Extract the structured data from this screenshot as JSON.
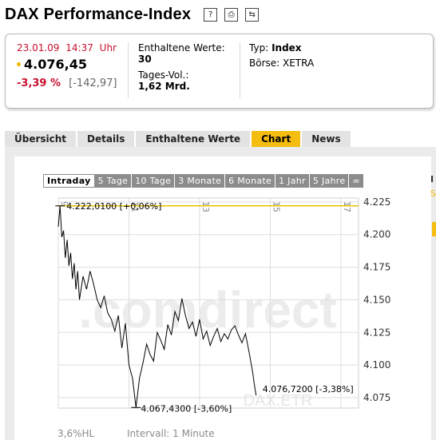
{
  "page": {
    "title": "DAX Performance-Index"
  },
  "title_icons": [
    {
      "name": "help-icon",
      "glyph": "?"
    },
    {
      "name": "print-icon",
      "glyph": "⎙"
    },
    {
      "name": "swap-icon",
      "glyph": "⇆"
    }
  ],
  "quote": {
    "date": "23.01.09",
    "time": "14:37 Uhr",
    "price": "4.076,45",
    "change_pct": "-3,39 %",
    "change_abs": "[-142,97]"
  },
  "stats": {
    "values_label": "Enthaltene Werte:",
    "values_count": "30",
    "volume_label": "Tages-Vol.:",
    "volume_value": "1,62 Mrd."
  },
  "meta": {
    "type_label": "Typ:",
    "type_value": "Index",
    "exchange": "Börse: XETRA"
  },
  "tabs": [
    "Übersicht",
    "Details",
    "Enthaltene Werte",
    "Chart",
    "News"
  ],
  "active_tab": "Chart",
  "chart_tabs": [
    "Intraday",
    "5 Tage",
    "10 Tage",
    "3 Monate",
    "6 Monate",
    "1 Jahr",
    "5 Jahre",
    "∞"
  ],
  "active_chart_tab": "Intraday",
  "right_cut_text": {
    "line1": "I",
    "line2": "S"
  },
  "footer": {
    "zoom": "3,6%HL",
    "interval": "Intervall: 1 Minute"
  },
  "colors": {
    "accent": "#f5bd0f",
    "negative": "#c8102e",
    "reference_line": "#e8c200"
  },
  "chart_data": {
    "type": "line",
    "title": "",
    "xlabel": "",
    "ylabel": "",
    "x_ticks": [
      "9",
      "11",
      "13",
      "15",
      "17"
    ],
    "y_ticks": [
      "4.225",
      "4.200",
      "4.175",
      "4.150",
      "4.125",
      "4.100",
      "4.075"
    ],
    "ylim": [
      4067,
      4228
    ],
    "xlim": [
      9,
      17.5
    ],
    "watermark": ".comdirect",
    "symbol_watermark": "DAX.ETR",
    "annotations": {
      "high": "4.222,0100 [+0,06%]",
      "low": "4.067,4300 [-3,60%]",
      "last": "4.076,7200 [-3,38%]"
    },
    "reference_value": 4222.01,
    "series": [
      {
        "name": "",
        "x": [
          9.0,
          9.05,
          9.1,
          9.15,
          9.2,
          9.25,
          9.3,
          9.35,
          9.4,
          9.45,
          9.5,
          9.55,
          9.6,
          9.7,
          9.8,
          9.9,
          10.0,
          10.1,
          10.2,
          10.3,
          10.4,
          10.5,
          10.6,
          10.7,
          10.8,
          10.9,
          11.0,
          11.1,
          11.2,
          11.3,
          11.4,
          11.5,
          11.6,
          11.7,
          11.8,
          11.9,
          12.0,
          12.1,
          12.2,
          12.3,
          12.4,
          12.5,
          12.6,
          12.7,
          12.8,
          12.9,
          13.0,
          13.1,
          13.2,
          13.3,
          13.4,
          13.5,
          13.6,
          13.7,
          13.8,
          13.9,
          14.0,
          14.1,
          14.2,
          14.3,
          14.4,
          14.5,
          14.55,
          14.6
        ],
        "y": [
          4206,
          4222,
          4198,
          4203,
          4182,
          4196,
          4176,
          4186,
          4166,
          4178,
          4158,
          4172,
          4150,
          4168,
          4158,
          4172,
          4162,
          4150,
          4144,
          4153,
          4140,
          4135,
          4126,
          4138,
          4113,
          4132,
          4100,
          4090,
          4067.43,
          4090,
          4102,
          4116,
          4108,
          4103,
          4125,
          4119,
          4112,
          4131,
          4123,
          4141,
          4134,
          4151,
          4138,
          4128,
          4133,
          4122,
          4135,
          4120,
          4126,
          4115,
          4122,
          4128,
          4118,
          4124,
          4120,
          4127,
          4130,
          4123,
          4117,
          4124,
          4110,
          4095,
          4085,
          4076.72
        ]
      }
    ]
  }
}
